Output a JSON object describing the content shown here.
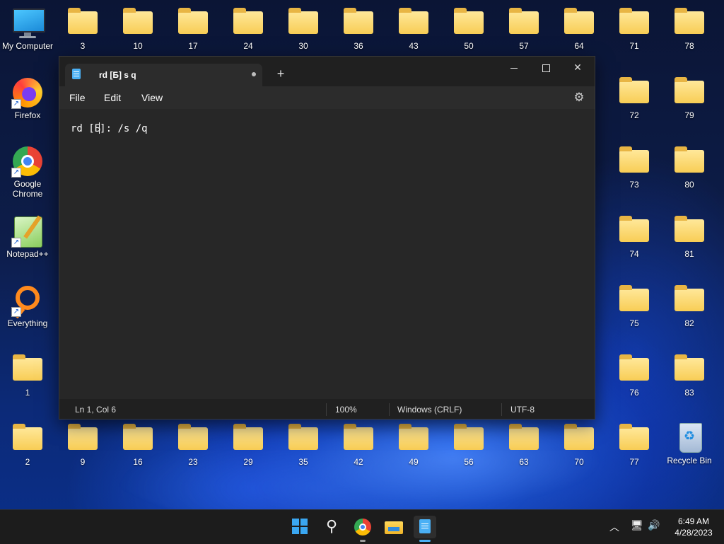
{
  "desktop": {
    "icons": [
      {
        "id": "mycomputer",
        "label": "My Computer"
      },
      {
        "id": "firefox",
        "label": "Firefox"
      },
      {
        "id": "chrome",
        "label": "Google Chrome"
      },
      {
        "id": "notepadpp",
        "label": "Notepad++"
      },
      {
        "id": "everything",
        "label": "Everything"
      },
      {
        "id": "recycle",
        "label": "Recycle Bin"
      }
    ],
    "folders": [
      "3",
      "10",
      "17",
      "24",
      "30",
      "36",
      "43",
      "50",
      "57",
      "64",
      "71",
      "78",
      "72",
      "79",
      "73",
      "80",
      "74",
      "81",
      "75",
      "82",
      "76",
      "83",
      "1",
      "2",
      "9",
      "16",
      "23",
      "29",
      "35",
      "42",
      "49",
      "56",
      "63",
      "70",
      "77"
    ]
  },
  "notepad": {
    "tab_title": "rd [Б] s q",
    "new_tab": "+",
    "menu": {
      "file": "File",
      "edit": "Edit",
      "view": "View"
    },
    "editor_before_caret": "rd [Б",
    "editor_after_caret": "]: /s /q",
    "status": {
      "position": "Ln 1, Col 6",
      "zoom": "100%",
      "line_ending": "Windows (CRLF)",
      "encoding": "UTF-8"
    }
  },
  "taskbar": {
    "time": "6:49 AM",
    "date": "4/28/2023"
  },
  "icons": {
    "gear": "⚙",
    "close": "✕",
    "search": "⚲",
    "chevron": "︿",
    "volume": "🔊",
    "network": "🖥"
  }
}
